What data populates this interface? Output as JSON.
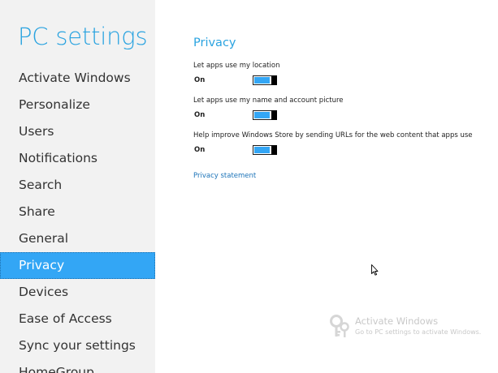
{
  "app": {
    "title": "PC settings"
  },
  "sidebar": {
    "items": [
      {
        "label": "Activate Windows"
      },
      {
        "label": "Personalize"
      },
      {
        "label": "Users"
      },
      {
        "label": "Notifications"
      },
      {
        "label": "Search"
      },
      {
        "label": "Share"
      },
      {
        "label": "General"
      },
      {
        "label": "Privacy",
        "selected": true
      },
      {
        "label": "Devices"
      },
      {
        "label": "Ease of Access"
      },
      {
        "label": "Sync your settings"
      },
      {
        "label": "HomeGroup"
      }
    ]
  },
  "main": {
    "section_title": "Privacy",
    "settings": [
      {
        "label": "Let apps use my location",
        "state": "On"
      },
      {
        "label": "Let apps use my name and account picture",
        "state": "On"
      },
      {
        "label": "Help improve Windows Store by sending URLs for the web content that apps use",
        "state": "On"
      }
    ],
    "link": "Privacy statement"
  },
  "watermark": {
    "title": "Activate Windows",
    "subtitle": "Go to PC settings to activate Windows."
  },
  "colors": {
    "accent": "#33a6f5",
    "title": "#2aa3e0",
    "sidebar_bg": "#f2f2f2",
    "link": "#1b73b8"
  }
}
